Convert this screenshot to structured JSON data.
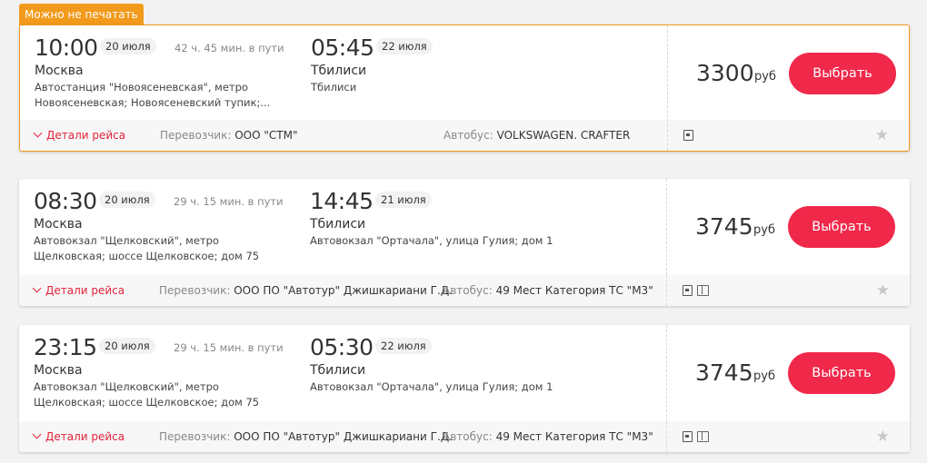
{
  "badge": "Можно не печатать",
  "common": {
    "select_label": "Выбрать",
    "currency": "руб",
    "details_label": "Детали рейса",
    "carrier_label": "Перевозчик:",
    "bus_label": "Автобус:"
  },
  "trips": [
    {
      "dep_time": "10:00",
      "dep_date": "20 июля",
      "duration": "42 ч. 45 мин. в пути",
      "dep_city": "Москва",
      "dep_addr": "Автостанция \"Новоясеневская\", метро Новоясеневская; Новоясеневский тупик;...",
      "arr_time": "05:45",
      "arr_date": "22 июля",
      "arr_city": "Тбилиси",
      "arr_addr": "Тбилиси",
      "price": "3300",
      "carrier": "ООО \"СТМ\"",
      "bus": "VOLKSWAGEN. CRAFTER",
      "highlight": true,
      "icons": [
        "document-icon"
      ]
    },
    {
      "dep_time": "08:30",
      "dep_date": "20 июля",
      "duration": "29 ч. 15 мин. в пути",
      "dep_city": "Москва",
      "dep_addr": "Автовокзал \"Щелковский\", метро Щелковская; шоссе Щелковское; дом 75",
      "arr_time": "14:45",
      "arr_date": "21 июля",
      "arr_city": "Тбилиси",
      "arr_addr": "Автовокзал \"Ортачала\", улица Гулия; дом 1",
      "price": "3745",
      "carrier": "ООО ПО \"Автотур\" Джишкариани Г.Д.",
      "bus": "49 Мест Категория ТС \"М3\"",
      "highlight": false,
      "icons": [
        "document-icon",
        "book-icon"
      ]
    },
    {
      "dep_time": "23:15",
      "dep_date": "20 июля",
      "duration": "29 ч. 15 мин. в пути",
      "dep_city": "Москва",
      "dep_addr": "Автовокзал \"Щелковский\", метро Щелковская; шоссе Щелковское; дом 75",
      "arr_time": "05:30",
      "arr_date": "22 июля",
      "arr_city": "Тбилиси",
      "arr_addr": "Автовокзал \"Ортачала\", улица Гулия; дом 1",
      "price": "3745",
      "carrier": "ООО ПО \"Автотур\" Джишкариани Г.Д.",
      "bus": "49 Мест Категория ТС \"М3\"",
      "highlight": false,
      "icons": [
        "document-icon",
        "book-icon"
      ]
    }
  ]
}
